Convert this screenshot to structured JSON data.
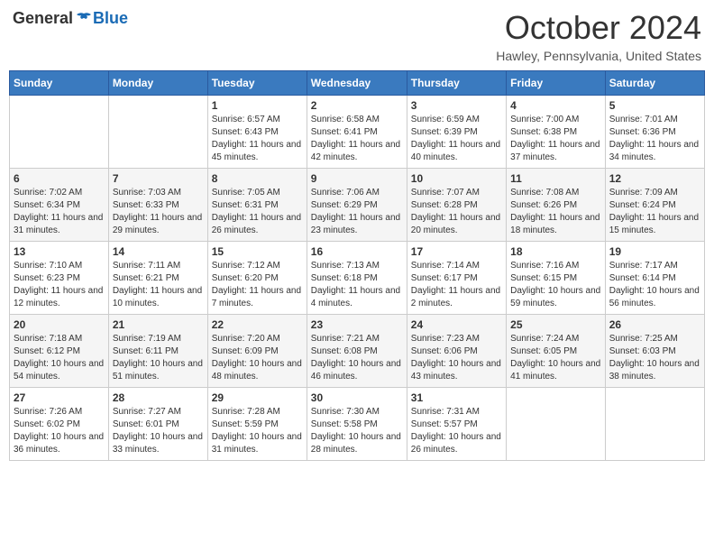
{
  "header": {
    "logo_general": "General",
    "logo_blue": "Blue",
    "month_year": "October 2024",
    "location": "Hawley, Pennsylvania, United States"
  },
  "days_of_week": [
    "Sunday",
    "Monday",
    "Tuesday",
    "Wednesday",
    "Thursday",
    "Friday",
    "Saturday"
  ],
  "weeks": [
    [
      null,
      null,
      {
        "day": 1,
        "sunrise": "Sunrise: 6:57 AM",
        "sunset": "Sunset: 6:43 PM",
        "daylight": "Daylight: 11 hours and 45 minutes."
      },
      {
        "day": 2,
        "sunrise": "Sunrise: 6:58 AM",
        "sunset": "Sunset: 6:41 PM",
        "daylight": "Daylight: 11 hours and 42 minutes."
      },
      {
        "day": 3,
        "sunrise": "Sunrise: 6:59 AM",
        "sunset": "Sunset: 6:39 PM",
        "daylight": "Daylight: 11 hours and 40 minutes."
      },
      {
        "day": 4,
        "sunrise": "Sunrise: 7:00 AM",
        "sunset": "Sunset: 6:38 PM",
        "daylight": "Daylight: 11 hours and 37 minutes."
      },
      {
        "day": 5,
        "sunrise": "Sunrise: 7:01 AM",
        "sunset": "Sunset: 6:36 PM",
        "daylight": "Daylight: 11 hours and 34 minutes."
      }
    ],
    [
      {
        "day": 6,
        "sunrise": "Sunrise: 7:02 AM",
        "sunset": "Sunset: 6:34 PM",
        "daylight": "Daylight: 11 hours and 31 minutes."
      },
      {
        "day": 7,
        "sunrise": "Sunrise: 7:03 AM",
        "sunset": "Sunset: 6:33 PM",
        "daylight": "Daylight: 11 hours and 29 minutes."
      },
      {
        "day": 8,
        "sunrise": "Sunrise: 7:05 AM",
        "sunset": "Sunset: 6:31 PM",
        "daylight": "Daylight: 11 hours and 26 minutes."
      },
      {
        "day": 9,
        "sunrise": "Sunrise: 7:06 AM",
        "sunset": "Sunset: 6:29 PM",
        "daylight": "Daylight: 11 hours and 23 minutes."
      },
      {
        "day": 10,
        "sunrise": "Sunrise: 7:07 AM",
        "sunset": "Sunset: 6:28 PM",
        "daylight": "Daylight: 11 hours and 20 minutes."
      },
      {
        "day": 11,
        "sunrise": "Sunrise: 7:08 AM",
        "sunset": "Sunset: 6:26 PM",
        "daylight": "Daylight: 11 hours and 18 minutes."
      },
      {
        "day": 12,
        "sunrise": "Sunrise: 7:09 AM",
        "sunset": "Sunset: 6:24 PM",
        "daylight": "Daylight: 11 hours and 15 minutes."
      }
    ],
    [
      {
        "day": 13,
        "sunrise": "Sunrise: 7:10 AM",
        "sunset": "Sunset: 6:23 PM",
        "daylight": "Daylight: 11 hours and 12 minutes."
      },
      {
        "day": 14,
        "sunrise": "Sunrise: 7:11 AM",
        "sunset": "Sunset: 6:21 PM",
        "daylight": "Daylight: 11 hours and 10 minutes."
      },
      {
        "day": 15,
        "sunrise": "Sunrise: 7:12 AM",
        "sunset": "Sunset: 6:20 PM",
        "daylight": "Daylight: 11 hours and 7 minutes."
      },
      {
        "day": 16,
        "sunrise": "Sunrise: 7:13 AM",
        "sunset": "Sunset: 6:18 PM",
        "daylight": "Daylight: 11 hours and 4 minutes."
      },
      {
        "day": 17,
        "sunrise": "Sunrise: 7:14 AM",
        "sunset": "Sunset: 6:17 PM",
        "daylight": "Daylight: 11 hours and 2 minutes."
      },
      {
        "day": 18,
        "sunrise": "Sunrise: 7:16 AM",
        "sunset": "Sunset: 6:15 PM",
        "daylight": "Daylight: 10 hours and 59 minutes."
      },
      {
        "day": 19,
        "sunrise": "Sunrise: 7:17 AM",
        "sunset": "Sunset: 6:14 PM",
        "daylight": "Daylight: 10 hours and 56 minutes."
      }
    ],
    [
      {
        "day": 20,
        "sunrise": "Sunrise: 7:18 AM",
        "sunset": "Sunset: 6:12 PM",
        "daylight": "Daylight: 10 hours and 54 minutes."
      },
      {
        "day": 21,
        "sunrise": "Sunrise: 7:19 AM",
        "sunset": "Sunset: 6:11 PM",
        "daylight": "Daylight: 10 hours and 51 minutes."
      },
      {
        "day": 22,
        "sunrise": "Sunrise: 7:20 AM",
        "sunset": "Sunset: 6:09 PM",
        "daylight": "Daylight: 10 hours and 48 minutes."
      },
      {
        "day": 23,
        "sunrise": "Sunrise: 7:21 AM",
        "sunset": "Sunset: 6:08 PM",
        "daylight": "Daylight: 10 hours and 46 minutes."
      },
      {
        "day": 24,
        "sunrise": "Sunrise: 7:23 AM",
        "sunset": "Sunset: 6:06 PM",
        "daylight": "Daylight: 10 hours and 43 minutes."
      },
      {
        "day": 25,
        "sunrise": "Sunrise: 7:24 AM",
        "sunset": "Sunset: 6:05 PM",
        "daylight": "Daylight: 10 hours and 41 minutes."
      },
      {
        "day": 26,
        "sunrise": "Sunrise: 7:25 AM",
        "sunset": "Sunset: 6:03 PM",
        "daylight": "Daylight: 10 hours and 38 minutes."
      }
    ],
    [
      {
        "day": 27,
        "sunrise": "Sunrise: 7:26 AM",
        "sunset": "Sunset: 6:02 PM",
        "daylight": "Daylight: 10 hours and 36 minutes."
      },
      {
        "day": 28,
        "sunrise": "Sunrise: 7:27 AM",
        "sunset": "Sunset: 6:01 PM",
        "daylight": "Daylight: 10 hours and 33 minutes."
      },
      {
        "day": 29,
        "sunrise": "Sunrise: 7:28 AM",
        "sunset": "Sunset: 5:59 PM",
        "daylight": "Daylight: 10 hours and 31 minutes."
      },
      {
        "day": 30,
        "sunrise": "Sunrise: 7:30 AM",
        "sunset": "Sunset: 5:58 PM",
        "daylight": "Daylight: 10 hours and 28 minutes."
      },
      {
        "day": 31,
        "sunrise": "Sunrise: 7:31 AM",
        "sunset": "Sunset: 5:57 PM",
        "daylight": "Daylight: 10 hours and 26 minutes."
      },
      null,
      null
    ]
  ]
}
